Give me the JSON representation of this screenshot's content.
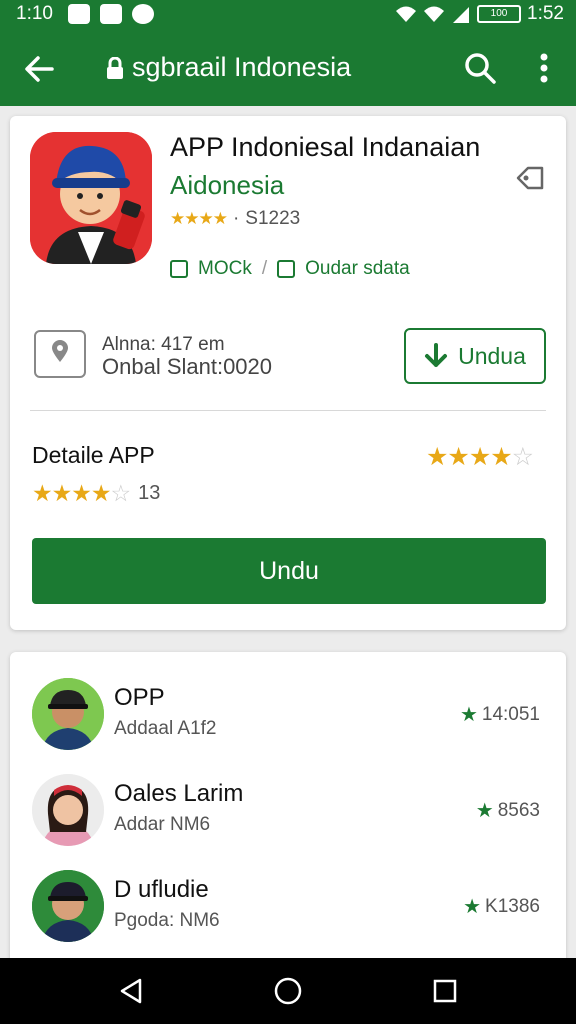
{
  "status": {
    "time": "1:10",
    "time_right": "1:52",
    "battery": "100"
  },
  "toolbar": {
    "title": "sgbraail Indonesia",
    "icons": [
      "back-arrow-icon",
      "lock-icon",
      "search-icon",
      "more-vert-icon"
    ]
  },
  "app": {
    "name": "APP Indoniesal Indanaian",
    "developer": "Aidonesia",
    "rating_text": "S1223",
    "tag1": "MOCk",
    "tag2": "Oudar sdata",
    "info_line1": "Alnna: 417 em",
    "info_line2": "Onbal Slant:0020",
    "download_outline": "Undua",
    "detail_title": "Detaile APP",
    "detail_rating": "13",
    "download_solid": "Undu",
    "accent_color": "#1b7a32",
    "star_color": "#e8a817"
  },
  "list": [
    {
      "name": "OPP",
      "sub": "Addaal A1f2",
      "score": "14:051"
    },
    {
      "name": "Oales  Larim",
      "sub": "Addar NM6",
      "score": "8563"
    },
    {
      "name": "D ufludie",
      "sub": "Pgoda: NM6",
      "score": "K1386"
    }
  ],
  "navbar": {
    "icons": [
      "back-triangle-icon",
      "home-circle-icon",
      "recents-square-icon"
    ]
  }
}
